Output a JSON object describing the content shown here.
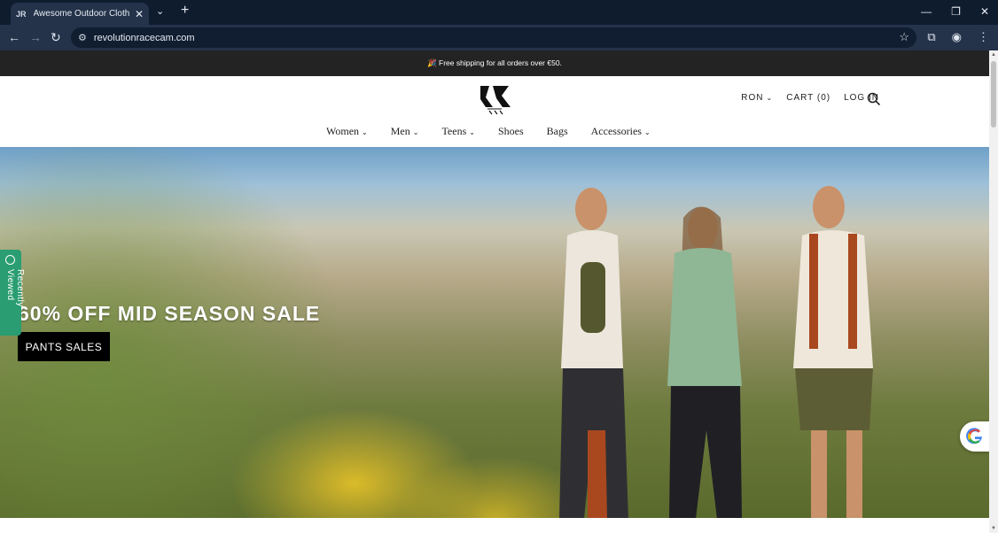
{
  "browser": {
    "tab_title": "Awesome Outdoor Clothes & G",
    "tab_close": "✕",
    "tab_favicon": "JR",
    "url": "revolutionracecam.com",
    "icons": {
      "back": "back-arrow-icon",
      "forward": "forward-arrow-icon",
      "reload": "reload-icon",
      "star": "bookmark-star-icon",
      "extensions": "puzzle-icon",
      "profile": "profile-icon",
      "menu": "kebab-menu-icon"
    }
  },
  "announcement": "🎉 Free shipping for all orders over €50.",
  "header": {
    "currency": "RON",
    "cart": "CART (0)",
    "login": "LOG IN"
  },
  "nav": [
    {
      "label": "Women",
      "has_dropdown": true
    },
    {
      "label": "Men",
      "has_dropdown": true
    },
    {
      "label": "Teens",
      "has_dropdown": true
    },
    {
      "label": "Shoes",
      "has_dropdown": false
    },
    {
      "label": "Bags",
      "has_dropdown": false
    },
    {
      "label": "Accessories",
      "has_dropdown": true
    }
  ],
  "hero": {
    "title": "60% OFF MID SEASON SALE",
    "button": "PANTS SALES"
  },
  "recently_viewed": "Recently Viewed",
  "colors": {
    "announcement_bg": "#232323",
    "recently_viewed_bg": "#2a9d72",
    "button_bg": "#000000"
  }
}
